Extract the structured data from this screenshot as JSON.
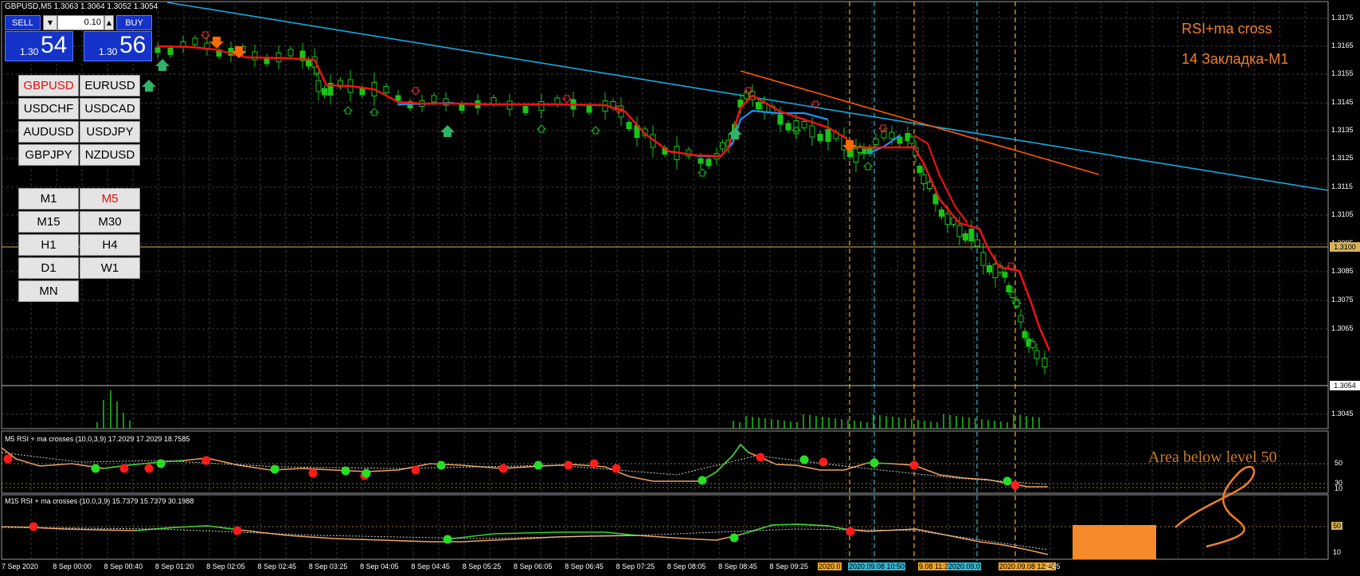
{
  "header": {
    "symbol_info": "GBPUSD,M5  1.3063 1.3064 1.3052 1.3054"
  },
  "trade_panel": {
    "sell_label": "SELL",
    "buy_label": "BUY",
    "lot": "0.10",
    "sell_prefix": "1.30",
    "sell_big": "54",
    "buy_prefix": "1.30",
    "buy_big": "56"
  },
  "symbols": [
    "GBPUSD",
    "EURUSD",
    "USDCHF",
    "USDCAD",
    "AUDUSD",
    "USDJPY",
    "GBPJPY",
    "NZDUSD"
  ],
  "active_symbol": "GBPUSD",
  "timeframes": [
    "M1",
    "M5",
    "M15",
    "M30",
    "H1",
    "H4",
    "D1",
    "W1",
    "MN"
  ],
  "active_timeframe": "M5",
  "annotations": {
    "title1": "RSI+ma cross",
    "title2": "14 Закладка-M1",
    "area_note": "Area below level 50"
  },
  "price_axis": {
    "ticks": [
      "1.3175",
      "1.3165",
      "1.3155",
      "1.3145",
      "1.3135",
      "1.3125",
      "1.3115",
      "1.3105",
      "1.3095",
      "1.3085",
      "1.3075",
      "1.3065",
      "1.3045"
    ],
    "level_label": "1.3100",
    "current_label": "1.3054"
  },
  "indicators": {
    "m5_title": "M5 RSI + ma crosses (10,0,3,9) 17.2029 17.2029 18.7585",
    "m15_title": "M15 RSI + ma crosses (10,0,3,9) 15.7379 15.7379 30.1988",
    "m5_levels": [
      "50",
      "30",
      "10"
    ],
    "m15_levels": [
      "50",
      "10"
    ]
  },
  "time_axis": {
    "labels": [
      "7 Sep 2020",
      "8 Sep 00:00",
      "8 Sep 00:40",
      "8 Sep 01:20",
      "8 Sep 02:05",
      "8 Sep 02:45",
      "8 Sep 03:25",
      "8 Sep 04:05",
      "8 Sep 04:45",
      "8 Sep 05:25",
      "8 Sep 06:05",
      "8 Sep 06:45",
      "8 Sep 07:25",
      "8 Sep 08:05",
      "8 Sep 08:45",
      "8 Sep 09:25"
    ],
    "tags": [
      {
        "text": "2020.0",
        "color": "#f5a623"
      },
      {
        "text": "2020.09.08 10:50",
        "color": "#33b7d1"
      },
      {
        "text": "9.08 11:20",
        "color": "#f5a623"
      },
      {
        "text": "2020.09.0",
        "color": "#33b7d1"
      },
      {
        "text": "2020.09.08 12:40",
        "color": "#f5a623"
      },
      {
        "text": "2:45",
        "color": "#000000"
      }
    ]
  },
  "colors": {
    "background": "#000000",
    "grid": "#3a3a3a",
    "bull_candle": "#19c419",
    "ma": "#ff1010",
    "trendline": "#18a8e0",
    "trendline2": "#ff5a00",
    "level_line": "#d4b15a",
    "annotation": "#f07f2a",
    "rsi_green": "#2fd42f",
    "rsi_orange": "#f0a060",
    "dot_red": "#ff1a1a",
    "dot_green": "#25e025"
  }
}
